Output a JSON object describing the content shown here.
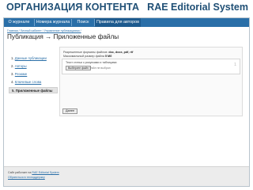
{
  "slide": {
    "title_left": "ОРГАНИЗАЦИЯ КОНТЕНТА",
    "title_right": "RAE Editorial System"
  },
  "nav": {
    "items": [
      {
        "label": "О журнале"
      },
      {
        "label": "Номера журнала"
      },
      {
        "label": "Поиск"
      },
      {
        "label": "Правила для авторов"
      }
    ]
  },
  "breadcrumb": "Главная / Личный кабинет / Управление публикациями /",
  "page_title": "Публикация → Приложенные файлы",
  "sidebar": {
    "items": [
      {
        "num": "1.",
        "label": "Данные публикации"
      },
      {
        "num": "2.",
        "label": "Авторы"
      },
      {
        "num": "3.",
        "label": "Резюме"
      },
      {
        "num": "4.",
        "label": "Ключевые слова"
      },
      {
        "num": "5.",
        "label": "Приложенные файлы",
        "active": true
      }
    ]
  },
  "content": {
    "formats_label": "Разрешенные форматы файлов:",
    "formats_value": "doc, docx, pdf, rtf",
    "maxsize_label": "Максимальный размер файла",
    "maxsize_value": "5 Mб",
    "file": {
      "description": "Текст статьи с рисунками и таблицами",
      "choose_label": "Выберите файл",
      "no_file_label": "Файл не выбран",
      "index": "1"
    },
    "save_label": "Далее"
  },
  "footer": {
    "line1_prefix": "Сайт работает на",
    "line1_link": "RAE Editorial System",
    "line2_link": "Обратиться в техподдержку"
  }
}
